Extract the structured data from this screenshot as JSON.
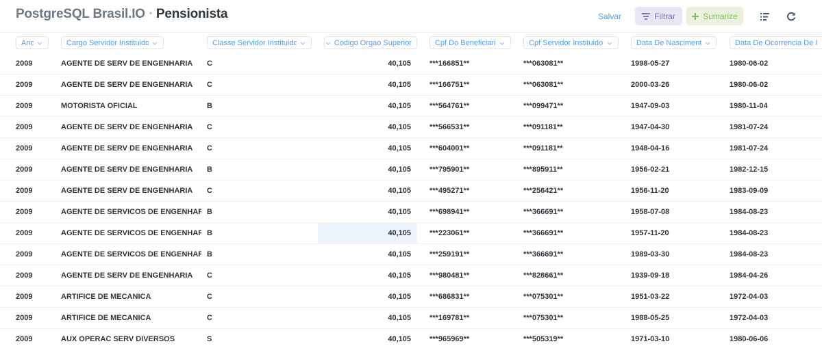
{
  "header": {
    "database": "PostgreSQL Brasil.IO",
    "separator": "•",
    "table_name": "Pensionista"
  },
  "actions": {
    "save_label": "Salvar",
    "filter_label": "Filtrar",
    "summarize_label": "Sumarize",
    "filter_icon": "filter-icon",
    "summarize_icon": "plus-icon",
    "list_icon": "list-icon",
    "refresh_icon": "refresh-icon"
  },
  "colors": {
    "accent": "#509ee3",
    "filter_bg": "#e8e6f6",
    "filter_fg": "#7172ad",
    "summarize_bg": "#e9f2dc",
    "summarize_fg": "#84bb4c",
    "highlight_cell": "#edf3fb"
  },
  "columns": [
    "Ano",
    "Cargo Servidor Instituidor",
    "Classe Servidor Instituidor",
    "Codigo Orgao Superior",
    "Cpf Do Beneficiario",
    "Cpf Servidor Instituidor",
    "Data De Nascimento",
    "Data De Ocorrencia De Ingresso"
  ],
  "rows": [
    [
      "2009",
      "AGENTE DE SERV DE ENGENHARIA",
      "C",
      "40,105",
      "***166851**",
      "***063081**",
      "1998-05-27",
      "1980-06-02"
    ],
    [
      "2009",
      "AGENTE DE SERV DE ENGENHARIA",
      "C",
      "40,105",
      "***166751**",
      "***063081**",
      "2000-03-26",
      "1980-06-02"
    ],
    [
      "2009",
      "MOTORISTA OFICIAL",
      "B",
      "40,105",
      "***564761**",
      "***099471**",
      "1947-09-03",
      "1980-11-04"
    ],
    [
      "2009",
      "AGENTE DE SERV DE ENGENHARIA",
      "C",
      "40,105",
      "***566531**",
      "***091181**",
      "1947-04-30",
      "1981-07-24"
    ],
    [
      "2009",
      "AGENTE DE SERV DE ENGENHARIA",
      "C",
      "40,105",
      "***604001**",
      "***091181**",
      "1948-04-16",
      "1981-07-24"
    ],
    [
      "2009",
      "AGENTE DE SERV DE ENGENHARIA",
      "B",
      "40,105",
      "***795901**",
      "***895911**",
      "1956-02-21",
      "1982-12-15"
    ],
    [
      "2009",
      "AGENTE DE SERV DE ENGENHARIA",
      "C",
      "40,105",
      "***495271**",
      "***256421**",
      "1956-11-20",
      "1983-09-09"
    ],
    [
      "2009",
      "AGENTE DE SERVICOS DE ENGENHARIA",
      "B",
      "40,105",
      "***698941**",
      "***366691**",
      "1958-07-08",
      "1984-08-23"
    ],
    [
      "2009",
      "AGENTE DE SERVICOS DE ENGENHARIA",
      "B",
      "40,105",
      "***223061**",
      "***366691**",
      "1957-11-20",
      "1984-08-23"
    ],
    [
      "2009",
      "AGENTE DE SERVICOS DE ENGENHARIA",
      "B",
      "40,105",
      "***259191**",
      "***366691**",
      "1989-03-30",
      "1984-08-23"
    ],
    [
      "2009",
      "AGENTE DE SERV DE ENGENHARIA",
      "C",
      "40,105",
      "***980481**",
      "***828661**",
      "1939-09-18",
      "1984-04-26"
    ],
    [
      "2009",
      "ARTIFICE DE MECANICA",
      "C",
      "40,105",
      "***686831**",
      "***075301**",
      "1951-03-22",
      "1972-04-03"
    ],
    [
      "2009",
      "ARTIFICE DE MECANICA",
      "C",
      "40,105",
      "***169781**",
      "***075301**",
      "1988-05-25",
      "1972-04-03"
    ],
    [
      "2009",
      "AUX OPERAC SERV DIVERSOS",
      "S",
      "40,105",
      "***965969**",
      "***505319**",
      "1971-03-10",
      "1980-06-06"
    ]
  ]
}
